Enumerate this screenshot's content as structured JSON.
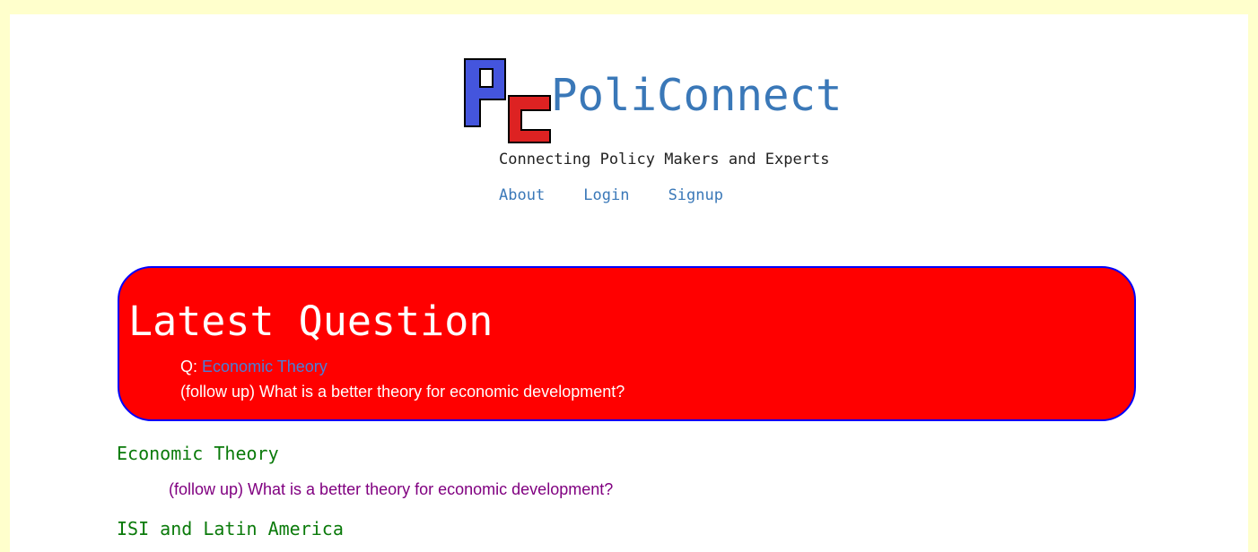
{
  "header": {
    "brand": "PoliConnect",
    "tagline": "Connecting Policy Makers and Experts",
    "nav": [
      "About",
      "Login",
      "Signup"
    ],
    "logo_colors": {
      "p": "#4455dd",
      "c": "#dd2222"
    }
  },
  "latest": {
    "title": "Latest Question",
    "q_prefix": "Q:",
    "topic_link": "Economic Theory",
    "question": "(follow up) What is a better theory for economic development?",
    "colors": {
      "background": "#ff0000",
      "border": "#0000ff"
    }
  },
  "topics": [
    {
      "name": "Economic Theory",
      "questions": [
        "(follow up) What is a better theory for economic development?"
      ]
    },
    {
      "name": "ISI and Latin America",
      "questions": []
    }
  ]
}
